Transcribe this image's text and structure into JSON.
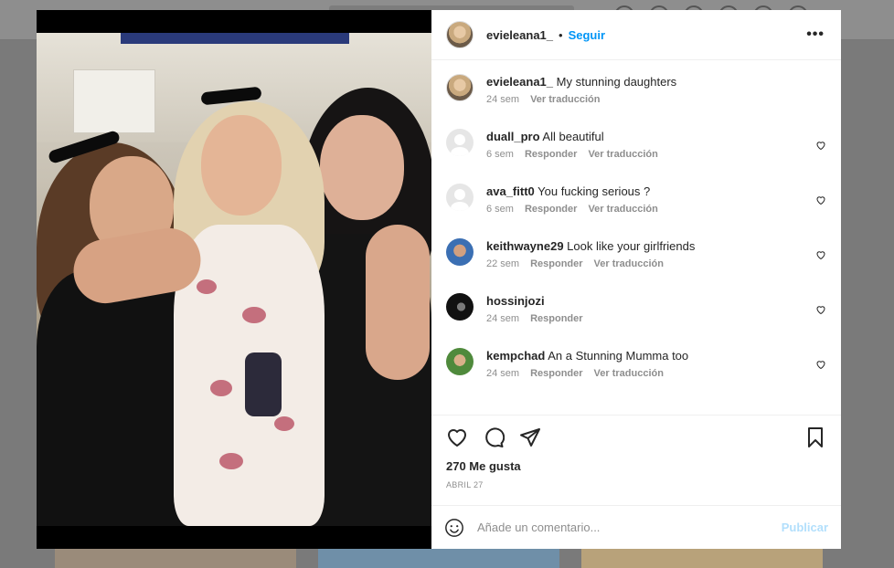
{
  "post": {
    "author": "evieleana1_",
    "follow_label": "Seguir",
    "more_label": "•••",
    "caption": {
      "user": "evieleana1_",
      "text": "My stunning daughters",
      "time": "24 sem",
      "translate": "Ver traducción"
    },
    "comments": [
      {
        "user": "duall_pro",
        "text": "All beautiful",
        "time": "6 sem",
        "reply": "Responder",
        "translate": "Ver traducción",
        "avatar": "default-avatar"
      },
      {
        "user": "ava_fitt0",
        "text": "You fucking serious ?",
        "time": "6 sem",
        "reply": "Responder",
        "translate": "Ver traducción",
        "avatar": "default-avatar"
      },
      {
        "user": "keithwayne29",
        "text": "Look like your girlfriends",
        "time": "22 sem",
        "reply": "Responder",
        "translate": "Ver traducción",
        "avatar": "profile-photo"
      },
      {
        "user": "hossinjozi",
        "text": "",
        "time": "24 sem",
        "reply": "Responder",
        "translate": "",
        "avatar": "profile-photo"
      },
      {
        "user": "kempchad",
        "text": "An a Stunning Mumma too",
        "time": "24 sem",
        "reply": "Responder",
        "translate": "Ver traducción",
        "avatar": "profile-photo"
      }
    ],
    "likes": "270 Me gusta",
    "date": "ABRIL 27",
    "add_comment_placeholder": "Añade un comentario...",
    "publish_label": "Publicar"
  },
  "colors": {
    "link_blue": "#0095f6",
    "publish_disabled": "#b2dffc",
    "muted_text": "#8e8e8e",
    "primary_text": "#262626"
  }
}
